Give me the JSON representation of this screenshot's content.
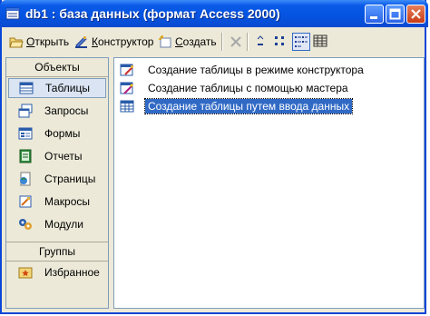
{
  "window": {
    "title": "db1 : база данных (формат Access 2000)",
    "buttons": {
      "minimize": "minimize-icon",
      "maximize": "maximize-icon",
      "close": "close-icon"
    }
  },
  "toolbar": {
    "open_label": "Открыть",
    "open_underline": "О",
    "design_label": "Конструктор",
    "design_underline": "К",
    "create_label": "Создать",
    "create_underline": "С"
  },
  "sidebar": {
    "objects_header": "Объекты",
    "groups_header": "Группы",
    "items": [
      {
        "label": "Таблицы",
        "icon": "table-icon",
        "selected": true
      },
      {
        "label": "Запросы",
        "icon": "query-icon"
      },
      {
        "label": "Формы",
        "icon": "form-icon"
      },
      {
        "label": "Отчеты",
        "icon": "report-icon"
      },
      {
        "label": "Страницы",
        "icon": "page-icon"
      },
      {
        "label": "Макросы",
        "icon": "macro-icon"
      },
      {
        "label": "Модули",
        "icon": "module-icon"
      }
    ],
    "favorites": {
      "label": "Избранное",
      "icon": "favorites-icon"
    }
  },
  "main": {
    "items": [
      {
        "label": "Создание таблицы в режиме конструктора",
        "icon": "design-table-icon"
      },
      {
        "label": "Создание таблицы с помощью мастера",
        "icon": "wizard-icon"
      },
      {
        "label": "Создание таблицы путем ввода данных",
        "icon": "datasheet-icon",
        "selected": true
      }
    ]
  },
  "colors": {
    "titlebar": "#0553e0",
    "selection": "#316ac5",
    "panel": "#ece9d8"
  }
}
